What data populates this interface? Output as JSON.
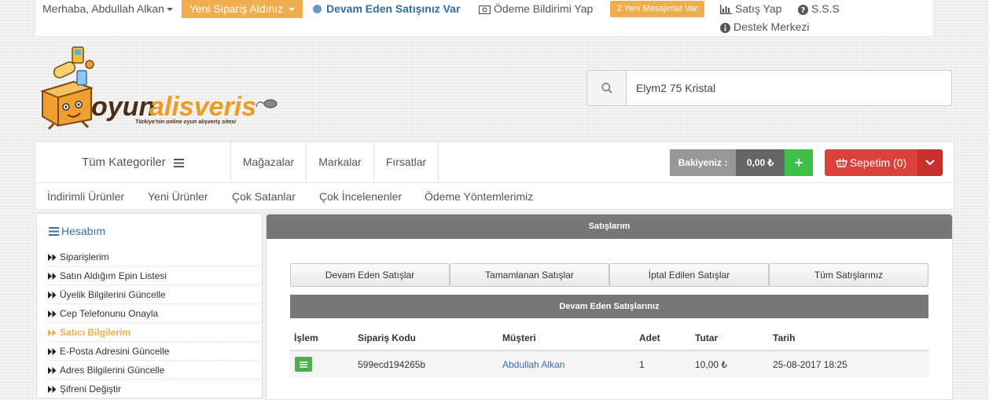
{
  "topbar": {
    "greeting": "Merhaba, Abdullah Alkan",
    "order_button": "Yeni Sipariş Aldınız",
    "ongoing_sale": "Devam Eden Satışınız Var",
    "payment_notice": "Ödeme Bildirimi Yap",
    "messages_badge": "2 Yeni Mesajımız Var",
    "sell": "Satış Yap",
    "faq": "S.S.S",
    "support": "Destek Merkezi"
  },
  "logo": {
    "name_part1": "oyun",
    "name_part2": "alisveris",
    "tagline": "Türkiye'nin online oyun alışveriş sitesi"
  },
  "search": {
    "value": "Elym2 75 Kristal"
  },
  "nav": {
    "categories": "Tüm Kategoriler",
    "stores": "Mağazalar",
    "brands": "Markalar",
    "deals": "Fırsatlar",
    "balance_label": "Bakiyeniz :",
    "balance_value": "0,00 ₺",
    "add_balance": "+",
    "cart": "Sepetim (0)",
    "sub": [
      "İndirimli Ürünler",
      "Yeni Ürünler",
      "Çok Satanlar",
      "Çok İncelenenler",
      "Ödeme Yöntemlerimiz"
    ]
  },
  "sidebar": {
    "title": "Hesabım",
    "items": [
      "Siparişlerim",
      "Satın Aldığım Epin Listesi",
      "Üyelik Bilgilerini Güncelle",
      "Cep Telefonunu Onayla",
      "Satıcı Bilgilerim",
      "E-Posta Adresini Güncelle",
      "Adres Bilgilerini Güncelle",
      "Şifreni Değiştir"
    ]
  },
  "panel": {
    "title": "Satışlarım",
    "tabs": [
      "Devam Eden Satışlar",
      "Tamamlanan Satışlar",
      "İptal Edilen Satışlar",
      "Tüm Satışlarınız"
    ],
    "section_title": "Devam Eden Satışlarınız",
    "columns": [
      "İşlem",
      "Sipariş Kodu",
      "Müşteri",
      "Adet",
      "Tutar",
      "Tarih"
    ],
    "rows": [
      {
        "order_code": "599ecd194265b",
        "customer": "Abdullah Alkan",
        "qty": "1",
        "amount": "10,00 ₺",
        "date": "25-08-2017 18:25"
      }
    ]
  },
  "colors": {
    "orange": "#f0ad4e",
    "blue_link": "#3a6ea5",
    "green": "#3ec04a",
    "red": "#d9413a",
    "gray_header": "#777777"
  }
}
